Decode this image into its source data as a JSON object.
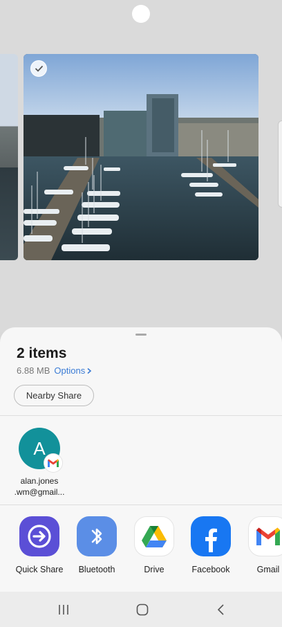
{
  "share_sheet": {
    "title": "2 items",
    "size": "6.88 MB",
    "options_label": "Options",
    "nearby_share_label": "Nearby Share"
  },
  "direct_share": {
    "contacts": [
      {
        "initial": "A",
        "name_line1": "alan.jones",
        "name_line2": ".wm@gmail...",
        "app_badge": "gmail-icon"
      }
    ]
  },
  "apps": [
    {
      "label": "Quick Share",
      "icon": "quick-share-icon",
      "color": "#5b4fd6"
    },
    {
      "label": "Bluetooth",
      "icon": "bluetooth-icon",
      "color": "#5b8ee6"
    },
    {
      "label": "Drive",
      "icon": "google-drive-icon",
      "color": "#ffffff"
    },
    {
      "label": "Facebook",
      "icon": "facebook-icon",
      "color": "#1877f2"
    },
    {
      "label": "Gmail",
      "icon": "gmail-icon",
      "color": "#ffffff"
    }
  ],
  "preview": {
    "selected_image": "harbor-photo",
    "selected": true
  },
  "nav": {
    "recents": "recent-apps-icon",
    "home": "home-icon",
    "back": "back-icon"
  }
}
